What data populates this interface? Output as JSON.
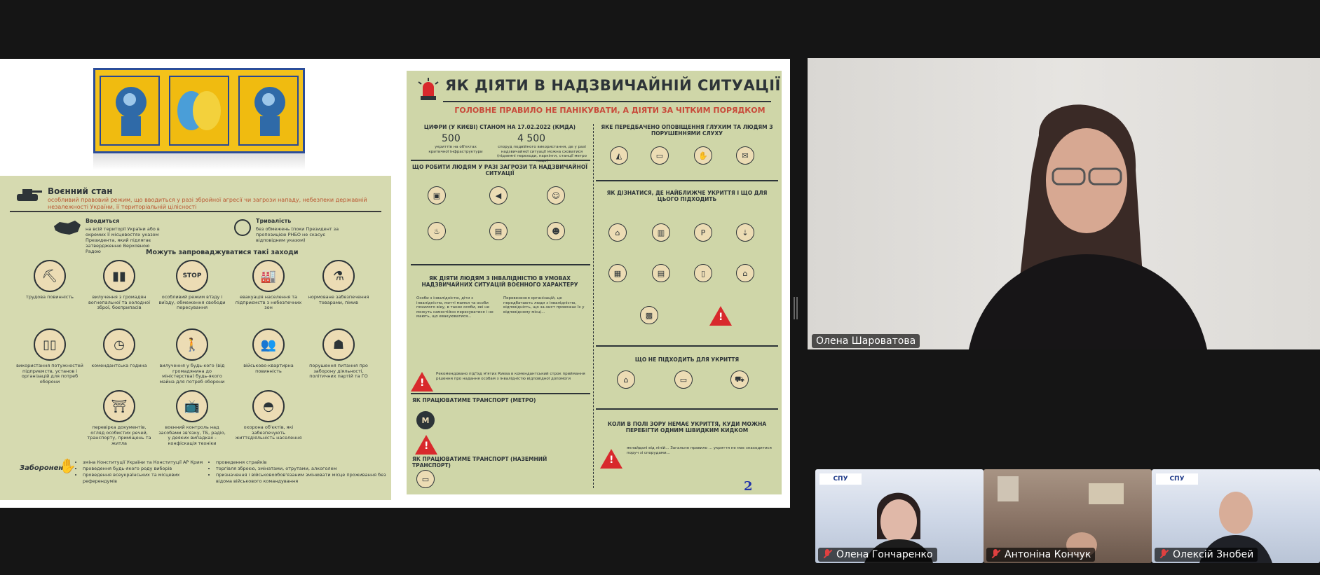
{
  "slide": {
    "left_panel": {
      "title": "Воєнний стан",
      "subtitle": "особливий правовий режим, що вводиться у разі збройної агресії чи загрози нападу, небезпеки державній незалежності України, її територіальній цілісності",
      "introduced_title": "Вводиться",
      "introduced_text": "на всій території України або в окремих її місцевостях указом Президента, який підлягає затвердженню Верховною Радою",
      "duration_title": "Триваліcть",
      "duration_text": "без обмежень (поки Президент за пропозицією РНБО не скасує відповідним указом)",
      "measures_heading": "Можуть запроваджуватися такі заходи",
      "measures": [
        {
          "icon": "shovel-icon",
          "label": "трудова повинність"
        },
        {
          "icon": "ammo-icon",
          "label": "вилучення з громадян вогнепальної та холодної зброї, боєприпасів"
        },
        {
          "icon": "stop-sign-icon",
          "label": "особливий режим в'їзду і виїзду, обмеження свободи пересування"
        },
        {
          "icon": "factory-icon",
          "label": "евакуація населення та підприємств з небезпечних зон"
        },
        {
          "icon": "bag-icon",
          "label": "нормоване забезпечення товарами, пімив"
        },
        {
          "icon": "gas-cylinder-icon",
          "label": "використання потужностей підприємств, установ і організацій для потреб оборони"
        },
        {
          "icon": "clock-icon",
          "label": "комендантська година"
        },
        {
          "icon": "mover-icon",
          "label": "вилучення у будь-кого (від громадянина до міністерства) будь-якого майна для потреб оборони"
        },
        {
          "icon": "people-icon",
          "label": "військово-квартирна повинність"
        },
        {
          "icon": "crowd-icon",
          "label": "порушення питання про заборону діяльності, політичних партій та ГО"
        },
        {
          "icon": "scanner-icon",
          "label": "перевірка документів, огляд особистих речей, транспорту, приміщень та житла"
        },
        {
          "icon": "tv-icon",
          "label": "воєнний контроль над засобами зв'язку, ТБ, радіо, у деяких випадках - конфіскація техніки"
        },
        {
          "icon": "helmet-icon",
          "label": "охорона об'єктів, які забезпечують життєдіяльність населення"
        }
      ],
      "forbidden_title": "Заборонено",
      "forbidden_col1": [
        "зміна Конституції України та Конституції АР Крим",
        "проведення будь-якого роду виборів",
        "проведення всеукраїнських та місцевих референдумів"
      ],
      "forbidden_col2": [
        "проведення страйків",
        "торгівля зброєю, змінатами, отрутами, алкоголем",
        "призначення і військовообов'язаним змінювати місце проживання без відома військового командування"
      ]
    },
    "right_panel": {
      "title": "ЯК ДІЯТИ В НАДЗВИЧАЙНІЙ СИТУАЦІЇ",
      "subtitle": "ГОЛОВНЕ ПРАВИЛО НЕ ПАНІКУВАТИ, А ДІЯТИ ЗА ЧІТКИМ ПОРЯДКОМ",
      "figures_heading": "ЦИФРИ (У КИЄВІ) СТАНОМ НА 17.02.2022 (КМДА)",
      "figure1_value": "500",
      "figure1_text": "укриттів на об'єктах критичної інфраструктури",
      "figure2_value": "4 500",
      "figure2_text": "споруд подвійного використання, де у разі надзвичайної ситуації можна сховатися (підземні переходи, паркінги, станції метро тощо)",
      "section_threat": "ЩО РОБИТИ ЛЮДЯМ У РАЗІ ЗАГРОЗИ ТА НАДЗВИЧАЙНОЇ СИТУАЦІЇ",
      "section_disability": "ЯК ДІЯТИ ЛЮДЯМ З ІНВАЛІДНІСТЮ В УМОВАХ НАДЗВИЧАЙНИХ СИТУАЦІЙ ВОЄННОГО ХАРАКТЕРУ",
      "section_metro": "ЯК ПРАЦЮВАТИМЕ ТРАНСПОРТ (МЕТРО)",
      "section_ground": "ЯК ПРАЦЮВАТИМЕ ТРАНСПОРТ (НАЗЕМНИЙ ТРАНСПОРТ)",
      "section_deaf": "ЯКЕ ПЕРЕДБАЧЕНО ОПОВІЩЕННЯ ГЛУХИМ ТА ЛЮДЯМ З ПОРУШЕННЯМИ СЛУХУ",
      "section_shelter": "ЯК ДІЗНАТИСЯ, ДЕ НАЙБЛИЖЧЕ УКРИТТЯ І ЩО ДЛЯ ЦЬОГО ПІДХОДИТЬ",
      "section_not_suitable": "ЩО НЕ ПІДХОДИТЬ ДЛЯ УКРИТТЯ",
      "section_no_shelter": "КОЛИ В ПОЛІ ЗОРУ НЕМАЄ УКРИТТЯ, КУДИ МОЖНА ПЕРЕБІГТИ ОДНИМ ШВИДКИМ КИДКОМ",
      "page_number": "2"
    }
  },
  "participants": {
    "main": {
      "name": "Олена Шароватова"
    },
    "thumbs": [
      {
        "name": "Олена Гончаренко",
        "bg": "univ"
      },
      {
        "name": "Антоніна Кончук",
        "bg": "home"
      },
      {
        "name": "Олексій Знобей",
        "bg": "univ"
      }
    ]
  },
  "colors": {
    "accent_red": "#d8292c",
    "panel_olive": "#d6dab0",
    "slide_bg": "#ffffff",
    "app_bg": "#151515"
  }
}
